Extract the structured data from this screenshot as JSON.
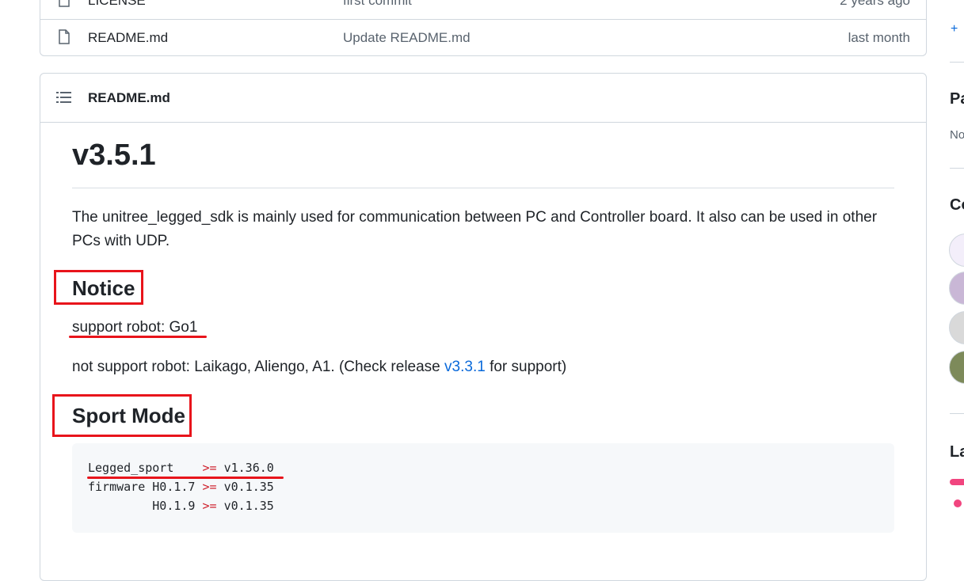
{
  "files": [
    {
      "name": "LICENSE",
      "message": "first commit",
      "date": "2 years ago"
    },
    {
      "name": "README.md",
      "message": "Update README.md",
      "date": "last month"
    }
  ],
  "readme": {
    "header_title": "README.md",
    "version_heading": "v3.5.1",
    "intro": "The unitree_legged_sdk is mainly used for communication between PC and Controller board. It also can be used in other PCs with UDP.",
    "notice_heading": "Notice",
    "support_line": "support robot: Go1",
    "not_support_prefix": "not support robot: Laikago, Aliengo, A1. (Check release ",
    "release_link": "v3.3.1",
    "not_support_suffix": " for support)",
    "sport_heading": "Sport Mode",
    "code_lines": [
      {
        "pre": "Legged_sport    ",
        "op": ">=",
        "post": " v1.36.0"
      },
      {
        "pre": "firmware H0.1.7 ",
        "op": ">=",
        "post": " v0.1.35"
      },
      {
        "pre": "         H0.1.9 ",
        "op": ">=",
        "post": " v0.1.35"
      }
    ]
  },
  "sidebar": {
    "plus": "+",
    "heading_1": "Pa",
    "text_1": "No",
    "heading_2": "Co",
    "heading_3": "La"
  },
  "colors": {
    "annotation_red": "#e8141b",
    "link_blue": "#0969da",
    "language_bar": "#f1457f"
  }
}
